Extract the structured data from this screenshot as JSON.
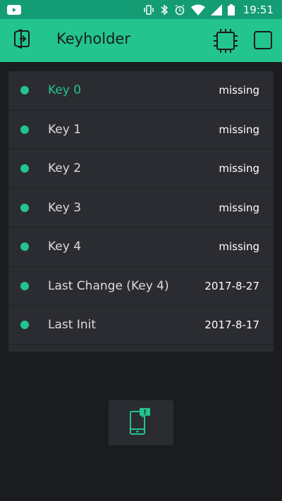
{
  "status_bar": {
    "time": "19:51",
    "icons": [
      "youtube-icon",
      "vibrate-icon",
      "bluetooth-icon",
      "alarm-icon",
      "wifi-icon",
      "signal-icon",
      "battery-icon"
    ]
  },
  "app_bar": {
    "title": "Keyholder",
    "icons": [
      "exit-icon",
      "device-chip-icon",
      "square-icon"
    ]
  },
  "list": {
    "items": [
      {
        "label": "Key 0",
        "value": "missing",
        "active": true
      },
      {
        "label": "Key 1",
        "value": "missing",
        "active": false
      },
      {
        "label": "Key 2",
        "value": "missing",
        "active": false
      },
      {
        "label": "Key 3",
        "value": "missing",
        "active": false
      },
      {
        "label": "Key 4",
        "value": "missing",
        "active": false
      },
      {
        "label": "Last Change (Key 4)",
        "value": "2017-8-27",
        "active": false
      },
      {
        "label": "Last Init",
        "value": "2017-8-17",
        "active": false
      }
    ]
  },
  "bottom_button": {
    "icon": "phone-notification-icon"
  },
  "colors": {
    "accent": "#23c48e",
    "status_bar": "#149d74",
    "background": "#1b1c1f",
    "card": "#2b2c31"
  }
}
